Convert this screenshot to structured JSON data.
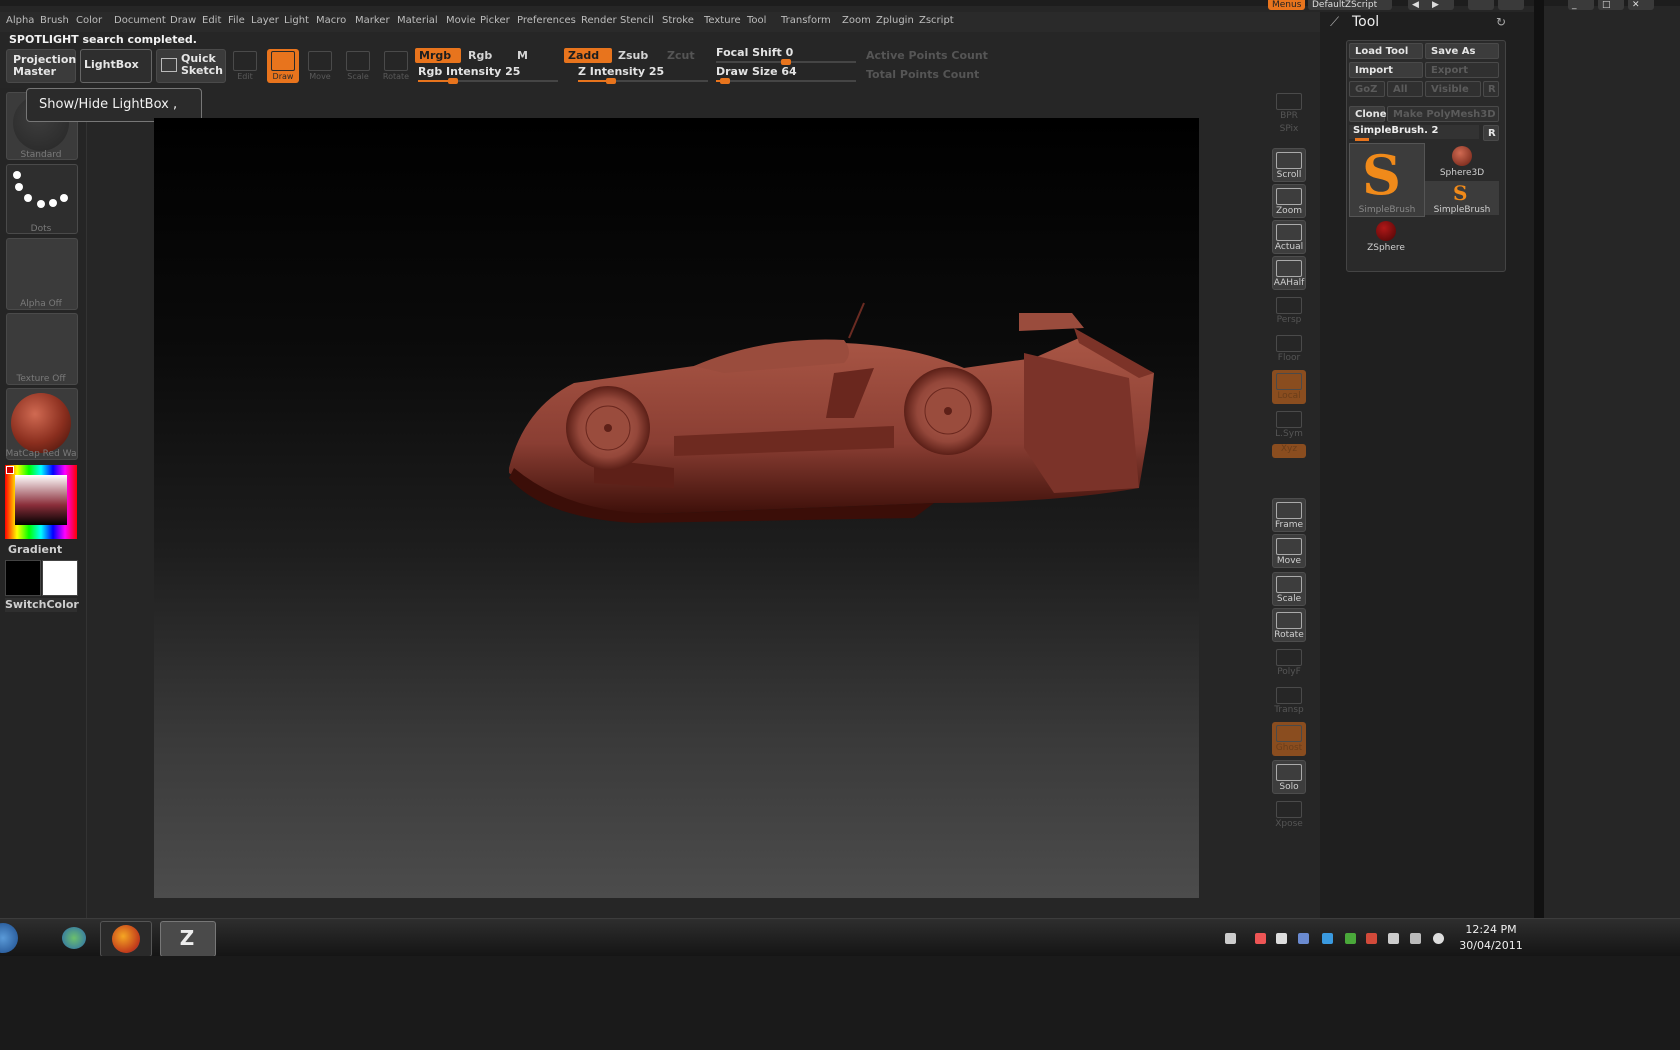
{
  "menus": [
    "Alpha",
    "Brush",
    "Color",
    "Document",
    "Draw",
    "Edit",
    "File",
    "Layer",
    "Light",
    "Macro",
    "Marker",
    "Material",
    "Movie",
    "Picker",
    "Preferences",
    "Render",
    "Stencil",
    "Stroke",
    "Texture",
    "Tool",
    "Transform",
    "Zoom",
    "Zplugin",
    "Zscript"
  ],
  "top_right": {
    "menus_label": "Menus",
    "script_label": "DefaultZScript"
  },
  "status": "SPOTLIGHT search completed.",
  "toolbar": {
    "projection_master": "Projection Master",
    "lightbox": "LightBox",
    "quick_sketch": "Quick Sketch",
    "edit": "Edit",
    "draw": "Draw",
    "move": "Move",
    "scale": "Scale",
    "rotate": "Rotate",
    "mrgb": "Mrgb",
    "rgb": "Rgb",
    "m": "M",
    "zadd": "Zadd",
    "zsub": "Zsub",
    "zcut": "Zcut",
    "rgb_intensity": "Rgb Intensity 25",
    "rgb_intensity_value": 25,
    "z_intensity": "Z Intensity 25",
    "z_intensity_value": 25,
    "focal_shift": "Focal Shift 0",
    "focal_shift_value": 0,
    "draw_size": "Draw Size 64",
    "draw_size_value": 64,
    "active_points": "Active Points Count",
    "total_points": "Total Points Count"
  },
  "tooltip": "Show/Hide LightBox ,",
  "left_shelf": {
    "standard": "Standard",
    "dots": "Dots",
    "alpha": "Alpha Off",
    "texture": "Texture Off",
    "material": "MatCap Red Wa",
    "gradient": "Gradient",
    "switch_color": "SwitchColor"
  },
  "right_shelf": [
    {
      "name": "bpr-button",
      "label": "BPR",
      "state": "dim",
      "icon": "bpr-icon"
    },
    {
      "name": "spix-label",
      "label": "SPix",
      "state": "dim",
      "icon": ""
    },
    {
      "name": "scroll-button",
      "label": "Scroll",
      "state": "active",
      "icon": "hand-icon"
    },
    {
      "name": "zoom-button",
      "label": "Zoom",
      "state": "active",
      "icon": "magnifier-icon"
    },
    {
      "name": "actual-button",
      "label": "Actual",
      "state": "active",
      "icon": "magnifier-icon"
    },
    {
      "name": "aahalf-button",
      "label": "AAHalf",
      "state": "active",
      "icon": "magnifier-icon"
    },
    {
      "name": "persp-button",
      "label": "Persp",
      "state": "dim",
      "icon": "grid-icon"
    },
    {
      "name": "floor-button",
      "label": "Floor",
      "state": "dim",
      "icon": "floor-icon"
    },
    {
      "name": "local-button",
      "label": "Local",
      "state": "orange",
      "icon": "local-icon"
    },
    {
      "name": "lsym-button",
      "label": "L.Sym",
      "state": "dim",
      "icon": "sym-icon"
    },
    {
      "name": "xyz-button",
      "label": "Xyz",
      "state": "orange",
      "icon": ""
    },
    {
      "name": "frame-button",
      "label": "Frame",
      "state": "active",
      "icon": "frame-icon"
    },
    {
      "name": "move-view-button",
      "label": "Move",
      "state": "active",
      "icon": "hand-icon"
    },
    {
      "name": "scale-view-button",
      "label": "Scale",
      "state": "active",
      "icon": "magnifier-icon"
    },
    {
      "name": "rotate-view-button",
      "label": "Rotate",
      "state": "active",
      "icon": "rotate-icon"
    },
    {
      "name": "polyf-button",
      "label": "PolyF",
      "state": "dim",
      "icon": "grid-icon"
    },
    {
      "name": "transp-button",
      "label": "Transp",
      "state": "dim",
      "icon": "transp-icon"
    },
    {
      "name": "ghost-button",
      "label": "Ghost",
      "state": "orange",
      "icon": "ghost-icon"
    },
    {
      "name": "solo-button",
      "label": "Solo",
      "state": "active",
      "icon": "solo-icon"
    },
    {
      "name": "xpose-button",
      "label": "Xpose",
      "state": "dim",
      "icon": "xpose-icon"
    }
  ],
  "tool_panel": {
    "title": "Tool",
    "load_tool": "Load Tool",
    "save_as": "Save As",
    "import": "Import",
    "export": "Export",
    "goz": "GoZ",
    "all": "All",
    "visible": "Visible",
    "r": "R",
    "clone": "Clone",
    "make_polymesh": "Make PolyMesh3D",
    "current_tool": "SimpleBrush. 2",
    "tiles": [
      "SimpleBrush",
      "Sphere3D",
      "SimpleBrush",
      "ZSphere"
    ]
  },
  "taskbar": {
    "time": "12:24 PM",
    "date": "30/04/2011"
  },
  "colors": {
    "accent": "#e8741d",
    "model": "#8a3e33",
    "background": "#262626"
  }
}
